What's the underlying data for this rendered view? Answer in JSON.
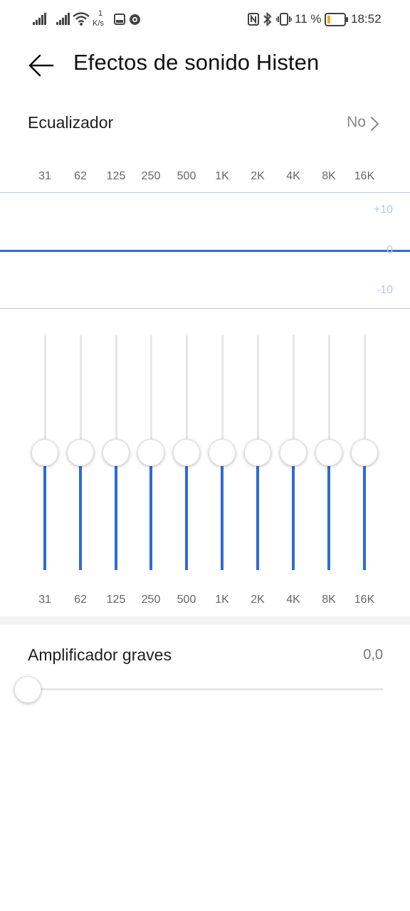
{
  "status_bar": {
    "net_speed_value": "1",
    "net_speed_unit": "K/s",
    "battery_percent": "11 %",
    "time": "18:52",
    "icons": [
      "signal-1-icon",
      "signal-2-icon",
      "wifi-icon",
      "image-icon",
      "circle-app-icon",
      "nfc-icon",
      "bluetooth-icon",
      "vibrate-icon",
      "battery-icon"
    ]
  },
  "header": {
    "title": "Efectos de sonido Histen"
  },
  "equalizer": {
    "label": "Ecualizador",
    "value": "No"
  },
  "frequencies": [
    "31",
    "62",
    "125",
    "250",
    "500",
    "1K",
    "2K",
    "4K",
    "8K",
    "16K"
  ],
  "curve": {
    "db_labels": [
      "+10",
      "0",
      "-10"
    ],
    "color": "#2f6bd8"
  },
  "band_gains_db": [
    0,
    0,
    0,
    0,
    0,
    0,
    0,
    0,
    0,
    0
  ],
  "bass_amplifier": {
    "label": "Amplificador graves",
    "value": "0,0",
    "level": 0
  },
  "colors": {
    "accent": "#2f6bd8",
    "track": "#e6e6e6",
    "battery_low": "#f5a623"
  }
}
